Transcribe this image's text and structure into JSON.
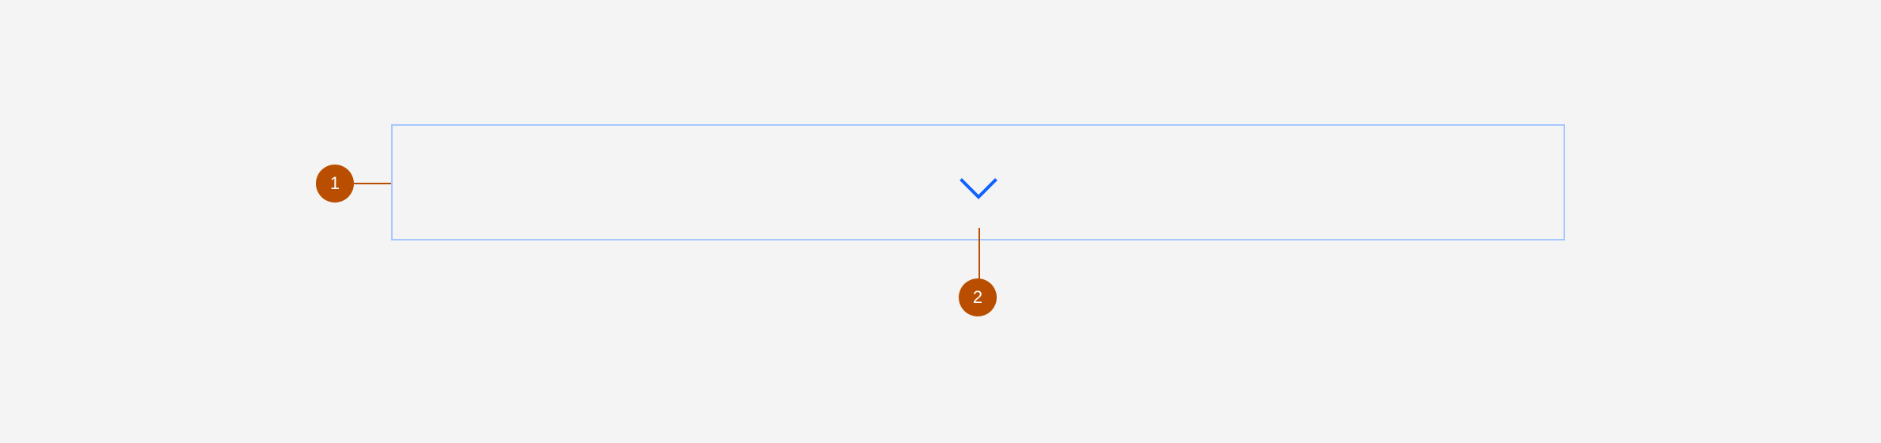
{
  "diagram": {
    "icon": "chevron-down-icon",
    "colors": {
      "background": "#f4f4f4",
      "container_border": "#a6c8ff",
      "chevron": "#0f62fe",
      "marker": "#ba4e00",
      "marker_text": "#ffffff"
    },
    "markers": [
      {
        "label": "1"
      },
      {
        "label": "2"
      }
    ]
  }
}
